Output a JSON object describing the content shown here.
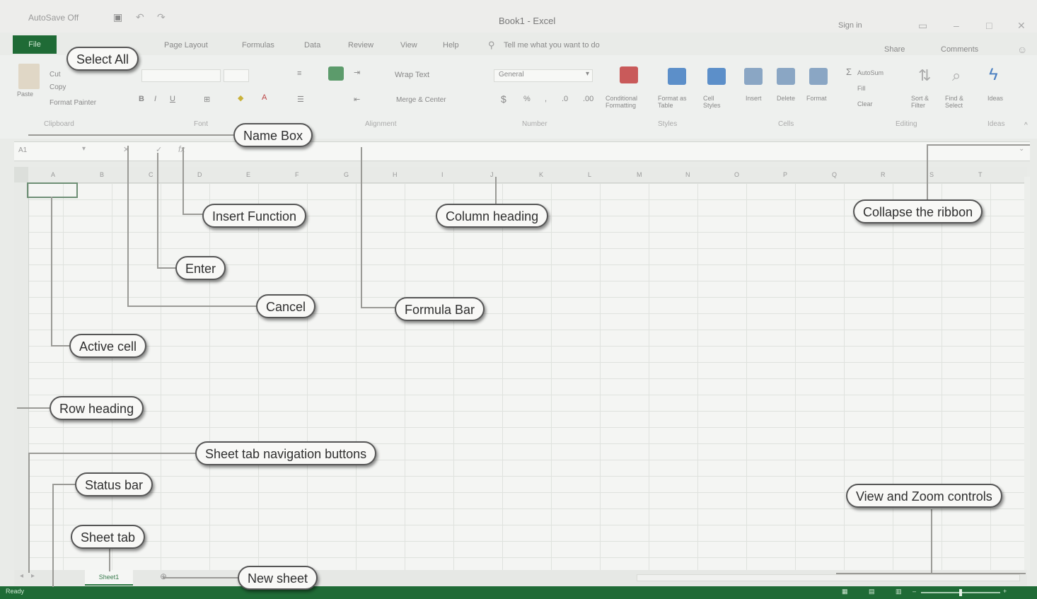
{
  "window": {
    "title": "Book1 - Excel",
    "signin": "Sign in",
    "qat": "AutoSave  Off"
  },
  "ribbon": {
    "file_tab": "File",
    "tabs": [
      "Page Layout",
      "Formulas",
      "Data",
      "Review",
      "View",
      "Help"
    ],
    "tell_me": "Tell me what you want to do",
    "share": "Share",
    "comments": "Comments",
    "wrap_text": "Wrap Text",
    "merge_center": "Merge & Center",
    "number_format": "General",
    "conditional_formatting": "Conditional Formatting",
    "format_as_table": "Format as Table",
    "cell_styles": "Cell Styles",
    "insert": "Insert",
    "delete": "Delete",
    "format": "Format",
    "autosum": "AutoSum",
    "fill": "Fill",
    "clear": "Clear",
    "sort_filter": "Sort & Filter",
    "find_select": "Find & Select",
    "ideas": "Ideas",
    "paste": "Paste",
    "cut": "Cut",
    "copy": "Copy",
    "format_painter": "Format Painter",
    "groups": {
      "clipboard": "Clipboard",
      "font": "Font",
      "alignment": "Alignment",
      "number": "Number",
      "styles": "Styles",
      "cells": "Cells",
      "editing": "Editing",
      "ideas": "Ideas"
    }
  },
  "formula_bar": {
    "name_box": "A1"
  },
  "grid": {
    "columns": [
      "A",
      "B",
      "C",
      "D",
      "E",
      "F",
      "G",
      "H",
      "I",
      "J",
      "K",
      "L",
      "M",
      "N",
      "O",
      "P",
      "Q",
      "R",
      "S",
      "T"
    ]
  },
  "sheet": {
    "tab_label": "Sheet1"
  },
  "status": {
    "ready": "Ready"
  },
  "callouts": {
    "select_all": "Select All",
    "name_box": "Name Box",
    "insert_function": "Insert Function",
    "column_heading": "Column heading",
    "collapse_ribbon": "Collapse the ribbon",
    "enter": "Enter",
    "cancel": "Cancel",
    "formula_bar": "Formula Bar",
    "active_cell": "Active cell",
    "row_heading": "Row heading",
    "sheet_tab_nav": "Sheet tab navigation buttons",
    "status_bar": "Status bar",
    "view_zoom": "View and Zoom controls",
    "sheet_tab": "Sheet tab",
    "new_sheet": "New sheet"
  },
  "colors": {
    "excel_green": "#1f6b36",
    "callout_border": "#565656"
  }
}
